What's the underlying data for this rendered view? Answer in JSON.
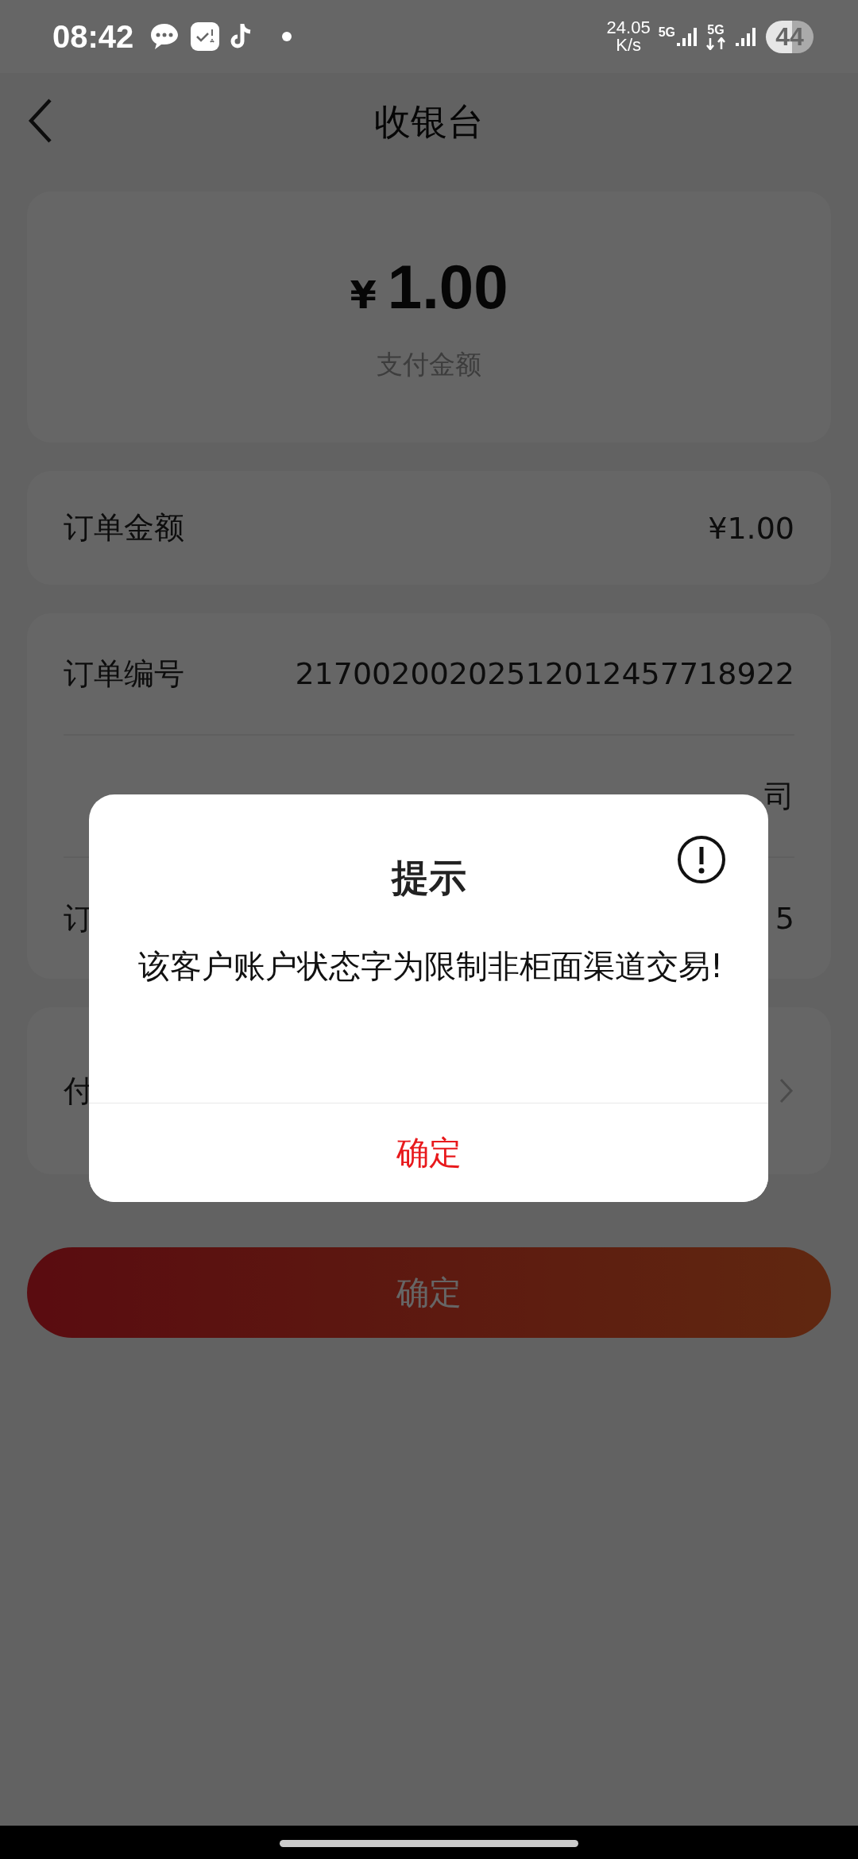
{
  "status_bar": {
    "time": "08:42",
    "net_speed": [
      "24.05",
      "K/s"
    ],
    "sim_labels": [
      "5G",
      "5G"
    ],
    "battery": "44"
  },
  "nav_bar": {
    "title": "收银台"
  },
  "amount_card": {
    "currency": "¥",
    "amount": "1.00",
    "caption": "支付金额"
  },
  "order_amount": {
    "label": "订单金额",
    "value": "¥1.00"
  },
  "details": [
    {
      "label": "订单编号",
      "value": "21700200202512012457718922"
    },
    {
      "value": "司"
    },
    {
      "label": "订",
      "value": "5"
    }
  ],
  "payment_row": {
    "label": "付",
    "chevron": true
  },
  "confirm_button": {
    "label": "确定"
  },
  "dialog": {
    "title": "提示",
    "message": "该客户账户状态字为限制非柜面渠道交易!",
    "button": "确定"
  }
}
